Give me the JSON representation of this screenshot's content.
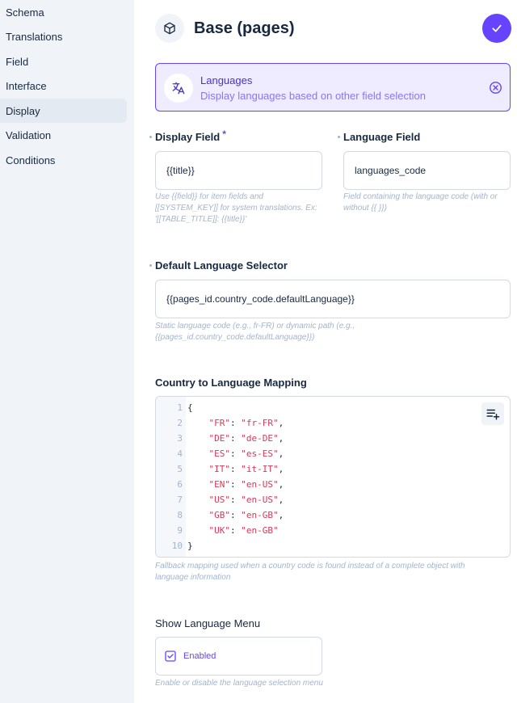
{
  "sidebar": {
    "items": [
      {
        "label": "Schema"
      },
      {
        "label": "Translations"
      },
      {
        "label": "Field"
      },
      {
        "label": "Interface"
      },
      {
        "label": "Display",
        "active": true
      },
      {
        "label": "Validation"
      },
      {
        "label": "Conditions"
      }
    ]
  },
  "header": {
    "title": "Base (pages)",
    "icon": "cube-icon",
    "save_icon": "check-icon"
  },
  "notice": {
    "title": "Languages",
    "description": "Display languages based on other field selection",
    "icon": "translate-icon"
  },
  "fields": {
    "display_field": {
      "label": "Display Field",
      "required_mark": "*",
      "value": "{{title}}",
      "hint": "Use {{field}} for item fields and [[SYSTEM_KEY]] for system translations. Ex: '[[TABLE_TITLE]]: {{title}}'"
    },
    "language_field": {
      "label": "Language Field",
      "value": "languages_code",
      "hint": "Field containing the language code (with or without {{ }})"
    },
    "default_language_selector": {
      "label": "Default Language Selector",
      "value": "{{pages_id.country_code.defaultLanguage}}",
      "hint": "Static language code (e.g., fr-FR) or dynamic path (e.g., {{pages_id.country_code.defaultLanguage}})"
    },
    "country_mapping": {
      "label": "Country to Language Mapping",
      "hint": "Fallback mapping used when a country code is found instead of a complete object with language information",
      "code_lines": [
        {
          "num": "1",
          "text": "{"
        },
        {
          "num": "2",
          "key": "\"FR\"",
          "val": "\"fr-FR\"",
          "comma": ","
        },
        {
          "num": "3",
          "key": "\"DE\"",
          "val": "\"de-DE\"",
          "comma": ","
        },
        {
          "num": "4",
          "key": "\"ES\"",
          "val": "\"es-ES\"",
          "comma": ","
        },
        {
          "num": "5",
          "key": "\"IT\"",
          "val": "\"it-IT\"",
          "comma": ","
        },
        {
          "num": "6",
          "key": "\"EN\"",
          "val": "\"en-US\"",
          "comma": ","
        },
        {
          "num": "7",
          "key": "\"US\"",
          "val": "\"en-US\"",
          "comma": ","
        },
        {
          "num": "8",
          "key": "\"GB\"",
          "val": "\"en-GB\"",
          "comma": ","
        },
        {
          "num": "9",
          "key": "\"UK\"",
          "val": "\"en-GB\"",
          "comma": ""
        },
        {
          "num": "10",
          "text": "}"
        }
      ]
    },
    "show_language_menu": {
      "label": "Show Language Menu",
      "checkbox_label": "Enabled",
      "checked": true,
      "hint": "Enable or disable the language selection menu"
    }
  },
  "colors": {
    "accent": "#6644ff",
    "string_token": "#d43b57",
    "hint": "#a2b5cd"
  }
}
